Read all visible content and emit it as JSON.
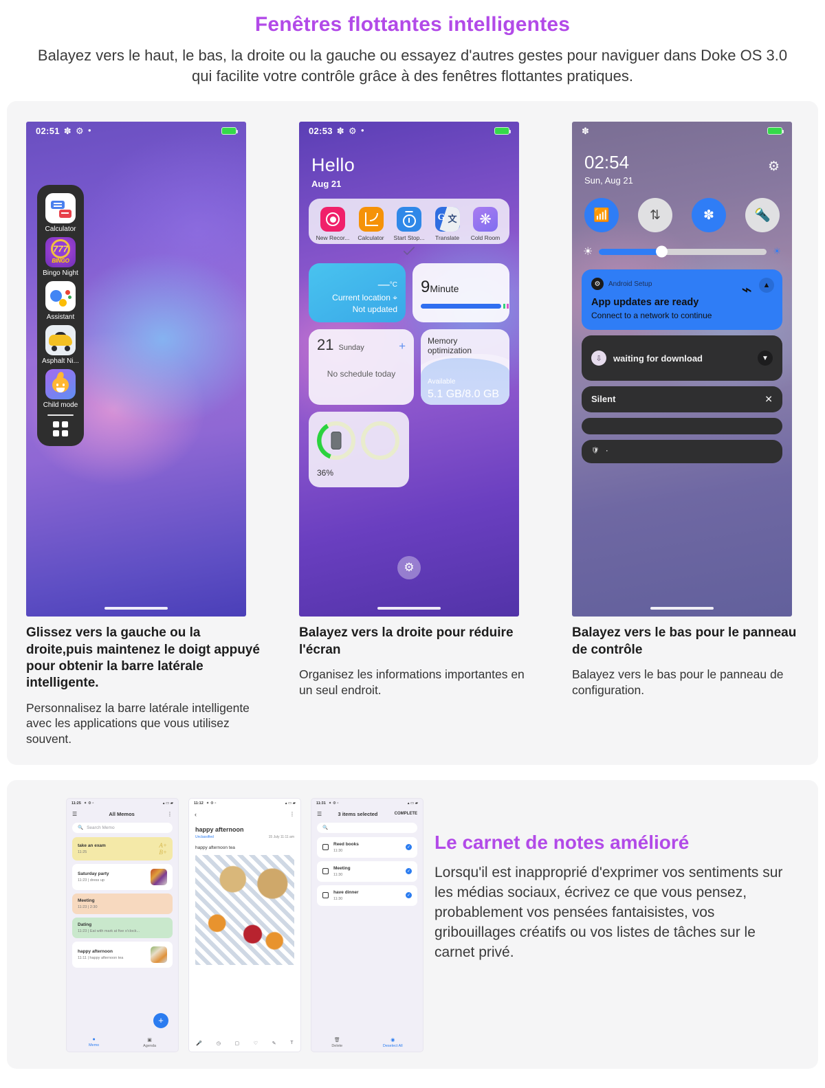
{
  "hero": {
    "title": "Fenêtres flottantes intelligentes",
    "subtitle": "Balayez vers le haut, le bas, la droite ou la gauche ou essayez d'autres gestes pour naviguer dans Doke OS 3.0 qui facilite votre contrôle grâce à des fenêtres flottantes pratiques."
  },
  "colors": {
    "accent": "#b24ae8",
    "blue": "#2f7df6",
    "green": "#2bd23f",
    "dark_panel": "#2f2f30",
    "sidebar": "#2e2e2e"
  },
  "phone1": {
    "status": {
      "time": "02:51",
      "bluetooth_icon": "bluetooth-icon",
      "gear_icon": "gear-icon",
      "dot_icon": "dot-icon",
      "battery_icon": "battery-icon"
    },
    "sidebar_apps": [
      {
        "label": "Calculator",
        "icon": "calculator-icon"
      },
      {
        "label": "Bingo Night",
        "icon": "bingo-icon"
      },
      {
        "label": "Assistant",
        "icon": "assistant-icon"
      },
      {
        "label": "Asphalt Ni...",
        "icon": "asphalt-icon"
      },
      {
        "label": "Child mode",
        "icon": "child-mode-icon"
      }
    ],
    "grid_button": "all-apps-grid-icon"
  },
  "phone2": {
    "status": {
      "time": "02:53"
    },
    "greeting": "Hello",
    "date": "Aug 21",
    "shortcuts": [
      {
        "label": "New Recor...",
        "icon": "recorder-icon"
      },
      {
        "label": "Calculator",
        "icon": "calculator-icon"
      },
      {
        "label": "Start Stop...",
        "icon": "stopwatch-icon"
      },
      {
        "label": "Translate",
        "icon": "translate-icon"
      },
      {
        "label": "Cold Room",
        "icon": "snowflake-icon"
      }
    ],
    "weather": {
      "unit": "°C",
      "value": "—",
      "location": "Current location",
      "status": "Not updated"
    },
    "timer": {
      "value": "9",
      "unit": "Minute"
    },
    "calendar": {
      "day": "21",
      "weekday": "Sunday",
      "add_icon": "plus-icon",
      "empty": "No schedule today"
    },
    "memory": {
      "title": "Memory optimization",
      "label": "Available",
      "value": "5.1 GB/8.0 GB"
    },
    "battery": {
      "percent": "36%"
    },
    "settings_icon": "gear-icon"
  },
  "phone3": {
    "status": {
      "bluetooth_icon": "bluetooth-icon"
    },
    "time": "02:54",
    "date": "Sun, Aug 21",
    "settings_icon": "gear-icon",
    "toggles": [
      {
        "name": "wifi-toggle",
        "state": "on",
        "icon": "wifi-icon"
      },
      {
        "name": "mobile-data-toggle",
        "state": "off",
        "icon": "data-arrows-icon"
      },
      {
        "name": "bluetooth-toggle",
        "state": "on",
        "icon": "bluetooth-icon"
      },
      {
        "name": "flashlight-toggle",
        "state": "off",
        "icon": "flashlight-icon"
      }
    ],
    "brightness": {
      "low_icon": "brightness-low-icon",
      "high_icon": "brightness-high-icon",
      "value": 37
    },
    "notifications": [
      {
        "app": "Android Setup",
        "title": "App updates are ready",
        "body": "Connect to a network to continue",
        "icon": "android-setup-icon",
        "accessory": "wifi-off-icon",
        "collapse": "chevron-up-icon"
      },
      {
        "title": "waiting for download",
        "icon": "download-icon",
        "accessory": "chevron-down-icon"
      },
      {
        "title": "Silent",
        "accessory": "close-icon"
      },
      {
        "title": "",
        "accessory": ""
      },
      {
        "title": "·",
        "icon": "shield-icon",
        "accessory": ""
      }
    ]
  },
  "captions": [
    {
      "title": "Glissez vers la gauche ou la droite,puis maintenez le doigt appuyé pour obtenir la barre latérale intelligente.",
      "body": "Personnalisez la barre latérale intelligente avec les applications que vous utilisez souvent."
    },
    {
      "title": "Balayez vers la droite pour réduire l'écran",
      "body": "Organisez les informations importantes en un seul endroit."
    },
    {
      "title": "Balayez vers le bas pour le panneau de contrôle",
      "body": "Balayez vers le bas pour le panneau de configuration."
    }
  ],
  "memo": {
    "panel1": {
      "status_time": "11:25",
      "title": "All Memos",
      "menu_icon": "overflow-menu-icon",
      "list_icon": "list-menu-icon",
      "search_placeholder": "Search Memo",
      "items": [
        {
          "title": "take an exam",
          "meta": "11:25",
          "thumb": "grade"
        },
        {
          "title": "Saturday party",
          "meta": "11:23 | dress up",
          "thumb": "party"
        },
        {
          "title": "Meeting",
          "meta": "11:23 | 2:30",
          "thumb": ""
        },
        {
          "title": "Dating",
          "meta": "11:23 | Eat with mark at five o'clock...",
          "thumb": ""
        },
        {
          "title": "happy afternoon",
          "meta": "11:11 | happy afternoon tea",
          "thumb": "tea"
        }
      ],
      "fab": "+",
      "nav": [
        {
          "label": "Memo",
          "icon": "memo-icon",
          "active": true
        },
        {
          "label": "Agenda",
          "icon": "agenda-icon",
          "active": false
        }
      ]
    },
    "panel2": {
      "status_time": "11:12",
      "back_icon": "back-arrow-icon",
      "menu_icon": "overflow-menu-icon",
      "note_title": "happy afternoon",
      "classification": "Unclassified",
      "datetime": "15 July 11:11 am",
      "body": "happy afternoon tea",
      "tools": [
        "mic-icon",
        "clock-icon",
        "image-icon",
        "tag-icon",
        "pen-icon",
        "text-icon"
      ]
    },
    "panel3": {
      "status_time": "11:31",
      "list_icon": "list-menu-icon",
      "title": "3 items selected",
      "complete_label": "COMPLETE",
      "search_placeholder": "",
      "items": [
        {
          "title": "Reed books",
          "meta": "11:30",
          "checked": true
        },
        {
          "title": "Meeting",
          "meta": "11:30",
          "checked": true
        },
        {
          "title": "have dinner",
          "meta": "11:30",
          "checked": true
        }
      ],
      "actions": [
        {
          "label": "Delete",
          "icon": "trash-icon"
        },
        {
          "label": "Deselect All",
          "icon": "deselect-icon"
        }
      ]
    }
  },
  "section2": {
    "title": "Le carnet de notes amélioré",
    "body": "Lorsqu'il est inapproprié d'exprimer vos sentiments sur les médias sociaux, écrivez ce que vous pensez, probablement vos pensées fantaisistes, vos gribouillages créatifs ou vos listes de tâches sur le carnet privé."
  }
}
